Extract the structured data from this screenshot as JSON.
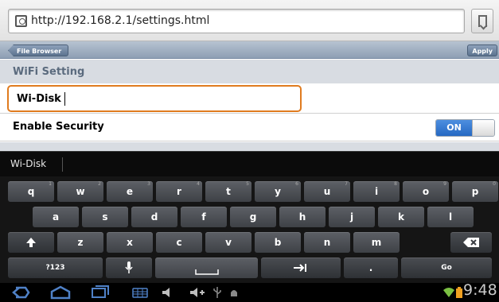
{
  "browser": {
    "url": "http://192.168.2.1/settings.html",
    "bookmark_icon": "bookmark-icon",
    "page_icon": "page-icon"
  },
  "page": {
    "back_label": "File Browser",
    "apply_label": "Apply",
    "section_title": "WiFi Setting",
    "ssid_value": "Wi-Disk",
    "security_label": "Enable Security",
    "security_state": "ON"
  },
  "suggestion": {
    "word": "Wi-Disk"
  },
  "keyboard": {
    "row1": [
      {
        "label": "q",
        "hint": "1"
      },
      {
        "label": "w",
        "hint": "2"
      },
      {
        "label": "e",
        "hint": "3"
      },
      {
        "label": "r",
        "hint": "4"
      },
      {
        "label": "t",
        "hint": "5"
      },
      {
        "label": "y",
        "hint": "6"
      },
      {
        "label": "u",
        "hint": "7"
      },
      {
        "label": "i",
        "hint": "8"
      },
      {
        "label": "o",
        "hint": "9"
      },
      {
        "label": "p",
        "hint": "0"
      }
    ],
    "row2": [
      "a",
      "s",
      "d",
      "f",
      "g",
      "h",
      "j",
      "k",
      "l"
    ],
    "row3": [
      "z",
      "x",
      "c",
      "v",
      "b",
      "n",
      "m"
    ],
    "shift_icon": "shift-icon",
    "backspace_icon": "backspace-icon",
    "symbols_label": "?123",
    "mic_icon": "microphone-icon",
    "space_icon": "space-icon",
    "tab_icon": "tab-icon",
    "period_label": ".",
    "go_label": "Go"
  },
  "system_bar": {
    "time": "9:48",
    "colors": {
      "accent_blue": "#2568c2",
      "focus_orange": "#e07b1f",
      "status_green": "#7bc043",
      "battery_orange": "#f0a020"
    }
  }
}
